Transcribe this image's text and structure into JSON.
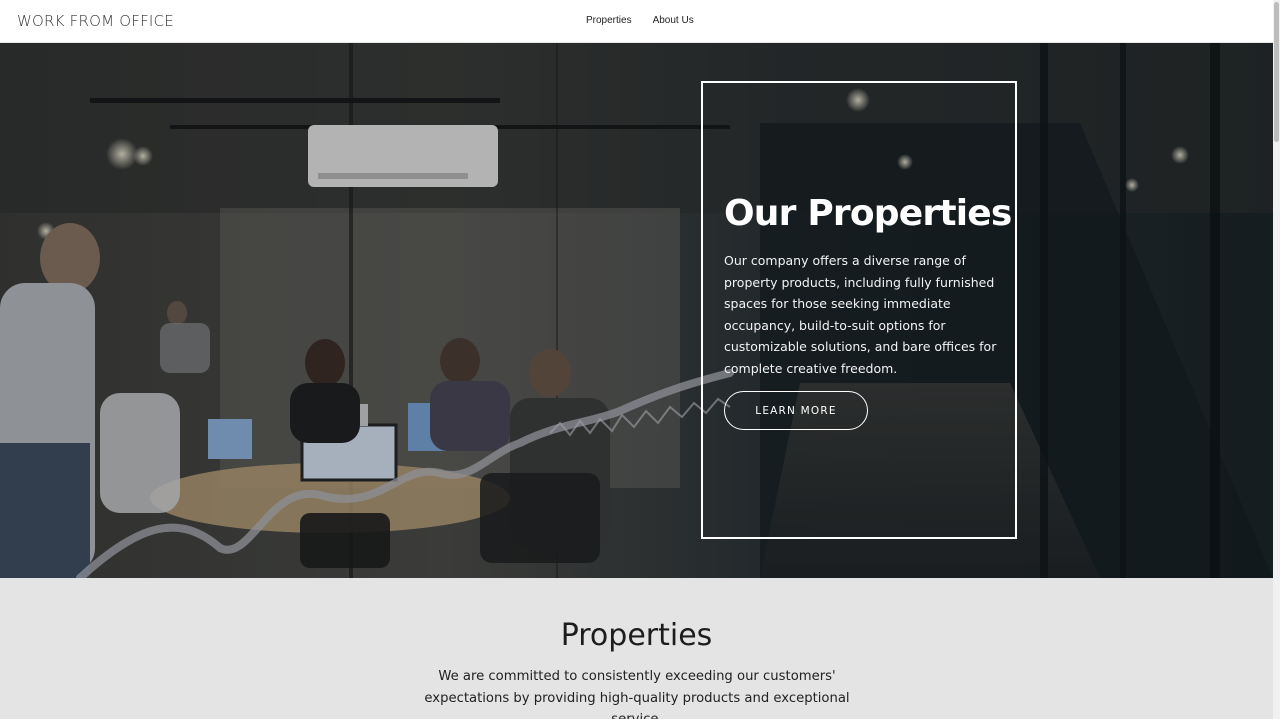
{
  "header": {
    "brand": "WORK FROM OFFICE",
    "nav": [
      {
        "label": "Properties"
      },
      {
        "label": "About Us"
      }
    ]
  },
  "hero": {
    "title": "Our Properties",
    "description": "Our company offers a diverse range of property products, including fully furnished spaces for those seeking immediate occupancy, build-to-suit options for customizable solutions, and bare offices for complete creative freedom.",
    "cta_label": "LEARN MORE",
    "image_subject": "office-meeting-room-photo"
  },
  "properties": {
    "title": "Properties",
    "description": "We are committed to consistently exceeding our customers' expectations by providing high-quality products and exceptional service."
  },
  "colors": {
    "hero_overlay": "#1b2326",
    "section_bg": "#e4e4e4",
    "card_border": "#ffffff"
  }
}
